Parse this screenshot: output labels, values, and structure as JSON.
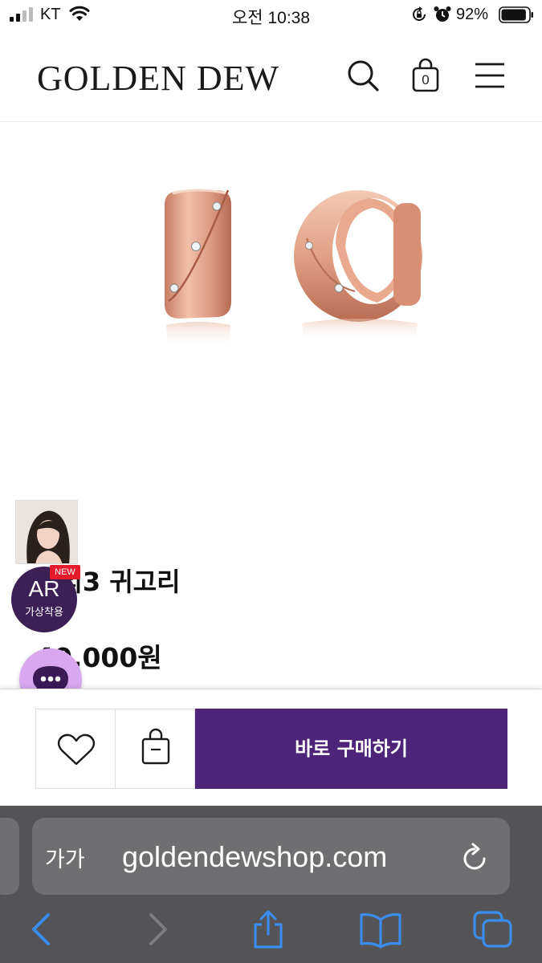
{
  "status_bar": {
    "carrier": "KT",
    "time": "오전 10:38",
    "battery_percent": "92%",
    "battery_level": 0.92
  },
  "header": {
    "logo": "GOLDEN DEW",
    "cart_count": "0",
    "icons": [
      "search-icon",
      "shopping-bag-icon",
      "hamburger-menu-icon"
    ]
  },
  "product": {
    "name": "갤러리3 귀고리",
    "name_visible": "러리3 귀고리",
    "price": "1,540,000원",
    "price_visible": "40,000원"
  },
  "ar_badge": {
    "new_tag": "NEW",
    "title": "AR",
    "subtitle": "가상착용"
  },
  "actions": {
    "buy_now": "바로 구매하기",
    "icons": [
      "heart-icon",
      "shopping-bag-icon"
    ]
  },
  "browser": {
    "text_size_label": "가가",
    "url": "goldendewshop.com",
    "icons": [
      "reload-icon",
      "back-icon",
      "forward-icon",
      "share-icon",
      "bookmarks-icon",
      "tabs-icon"
    ]
  },
  "colors": {
    "brand_purple": "#4e2478",
    "ar_badge": "#3b1f55",
    "chat_bubble": "#d9a7f0",
    "new_tag": "#e41b2c",
    "rose_gold": "#d9957a"
  }
}
